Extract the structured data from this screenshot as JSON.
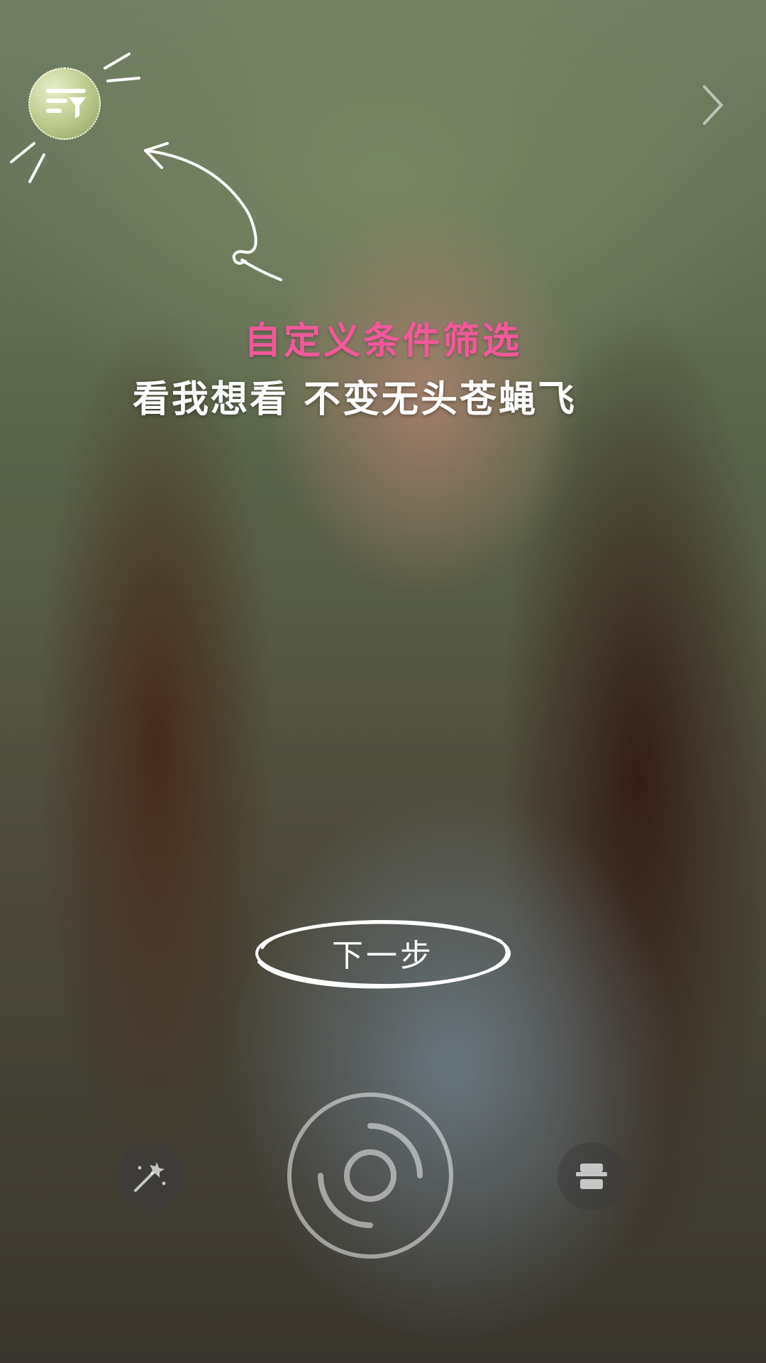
{
  "headline": {
    "pink": "自定义条件筛选",
    "white": "看我想看 不变无头苍蝇飞"
  },
  "next_button": {
    "label": "下一步"
  },
  "icons": {
    "filter": "filter-icon",
    "forward": "chevron-right-icon",
    "shutter": "shutter-icon",
    "magic": "magic-wand-icon",
    "stamp": "stamp-icon"
  },
  "colors": {
    "accent_pink": "#f2589a",
    "text_white": "#ffffff"
  }
}
